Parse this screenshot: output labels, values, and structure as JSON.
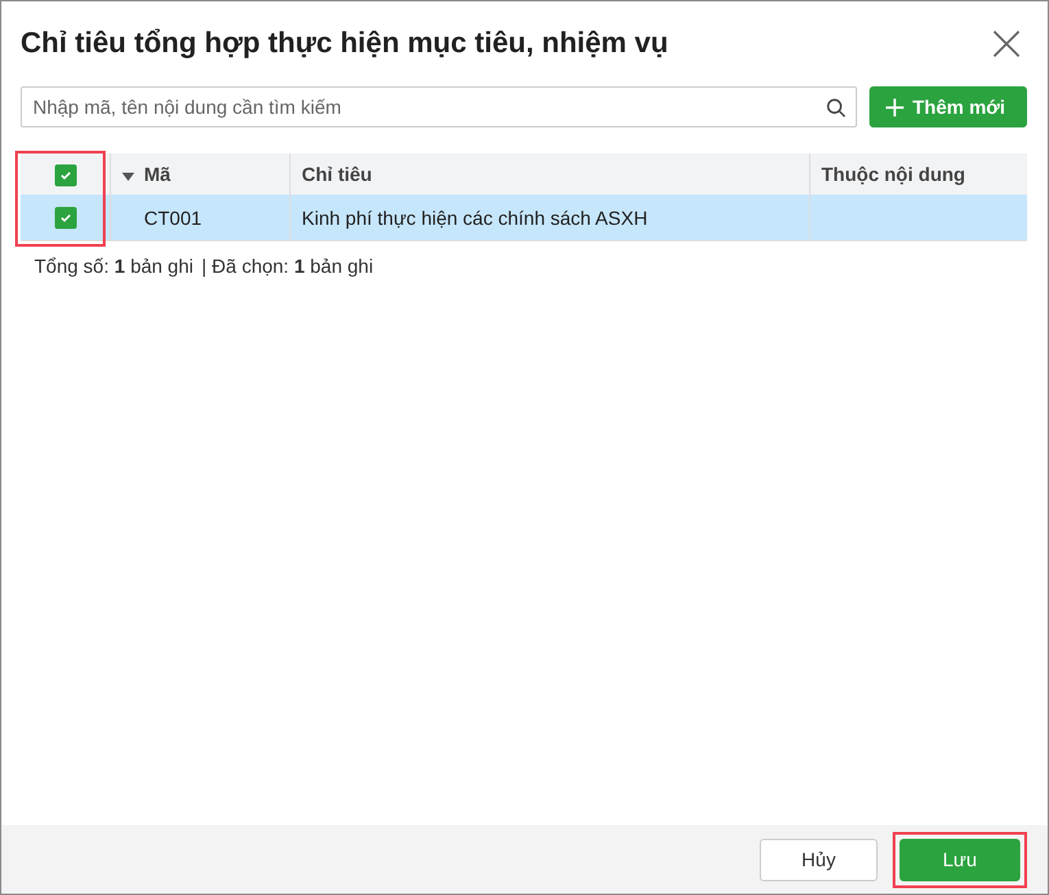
{
  "dialog": {
    "title": "Chỉ tiêu tổng hợp thực hiện mục tiêu, nhiệm vụ"
  },
  "search": {
    "placeholder": "Nhập mã, tên nội dung cần tìm kiếm"
  },
  "add_button": {
    "label": "Thêm mới"
  },
  "table": {
    "select_all": {
      "checked": true
    },
    "checkbox_column_highlighted": true,
    "columns": [
      {
        "label": "Mã",
        "sorted": true
      },
      {
        "label": "Chỉ tiêu",
        "sorted": false
      },
      {
        "label": "Thuộc nội dung",
        "sorted": false
      }
    ],
    "rows": [
      {
        "selected": true,
        "checked": true,
        "cells": [
          "CT001",
          "Kinh phí thực hiện các chính sách ASXH",
          ""
        ]
      }
    ]
  },
  "summary": {
    "total_label": "Tổng số:",
    "total": "1",
    "total_unit": "bản ghi",
    "selected_label": "| Đã chọn:",
    "selected": "1",
    "selected_unit": "bản ghi"
  },
  "buttons": [
    {
      "label": "Hủy",
      "kind": "secondary",
      "highlighted": false
    },
    {
      "label": "Lưu",
      "kind": "primary",
      "highlighted": true
    }
  ]
}
